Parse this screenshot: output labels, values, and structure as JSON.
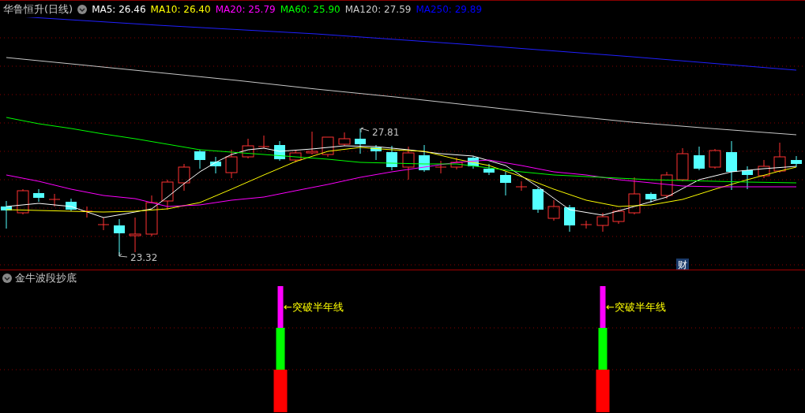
{
  "header": {
    "title": "华鲁恒升(日线)",
    "moving_averages": [
      {
        "label": "MA5: 26.46",
        "color": "#ffffff"
      },
      {
        "label": "MA10: 26.40",
        "color": "#ffff00"
      },
      {
        "label": "MA20: 25.79",
        "color": "#ff00ff"
      },
      {
        "label": "MA60: 25.90",
        "color": "#00ff00"
      },
      {
        "label": "MA120: 27.59",
        "color": "#c8c8c8"
      },
      {
        "label": "MA250: 29.89",
        "color": "#0000ff"
      }
    ]
  },
  "price_chart": {
    "high_marker": "27.81",
    "low_marker": "23.32",
    "finance_badge": "财"
  },
  "indicator_panel": {
    "title": "金牛波段抄底",
    "signals": [
      {
        "label": "←突破半年线"
      },
      {
        "label": "←突破半年线"
      }
    ]
  }
}
